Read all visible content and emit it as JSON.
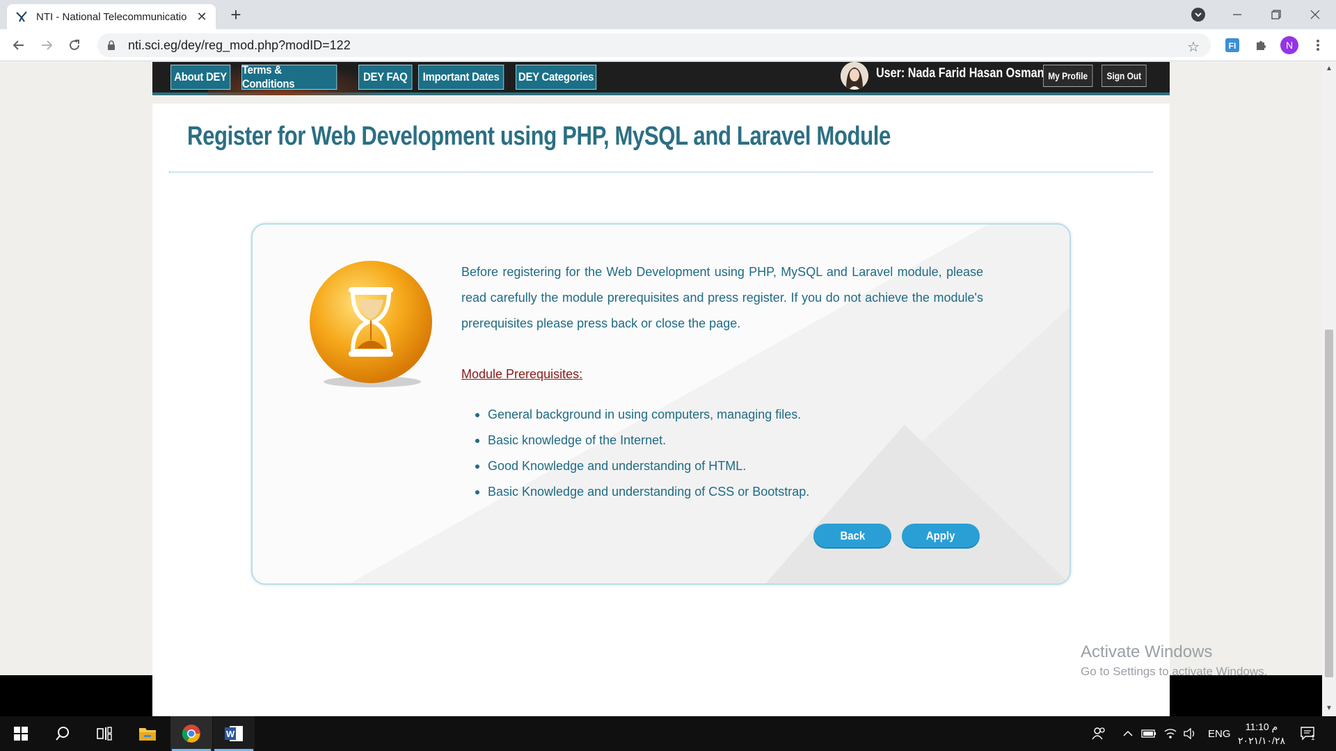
{
  "browser": {
    "tab_title": "NTI - National Telecommunicatio",
    "tab_close": "✕",
    "new_tab": "+",
    "url": "nti.sci.eg/dey/reg_mod.php?modID=122",
    "profile_initial": "N",
    "extension_label": "FI"
  },
  "site_nav": {
    "items": [
      {
        "label": "About DEY"
      },
      {
        "label": "Terms & Conditions"
      },
      {
        "label": "DEY FAQ"
      },
      {
        "label": "Important Dates"
      },
      {
        "label": "DEY Categories"
      }
    ],
    "user_label": "User: Nada Farid Hasan Osman",
    "my_profile": "My Profile",
    "sign_out": "Sign Out"
  },
  "page": {
    "title": "Register for Web Development using PHP, MySQL and Laravel Module",
    "intro": "Before registering for the Web Development using PHP, MySQL and Laravel module, please read carefully the module prerequisites and press register. If you do not achieve the module's prerequisites please press back or close the page.",
    "prereq_heading": "Module Prerequisites:",
    "prerequisites": [
      "General background in using computers, managing files.",
      "Basic knowledge of the Internet.",
      "Good Knowledge and understanding of HTML.",
      "Basic Knowledge and understanding of CSS or Bootstrap."
    ],
    "back_label": "Back",
    "apply_label": "Apply"
  },
  "watermark": {
    "line1": "Activate Windows",
    "line2": "Go to Settings to activate Windows."
  },
  "taskbar": {
    "language": "ENG",
    "time": "11:10 م",
    "date": "٢٠٢١/١٠/٢٨",
    "notifications": "1"
  }
}
